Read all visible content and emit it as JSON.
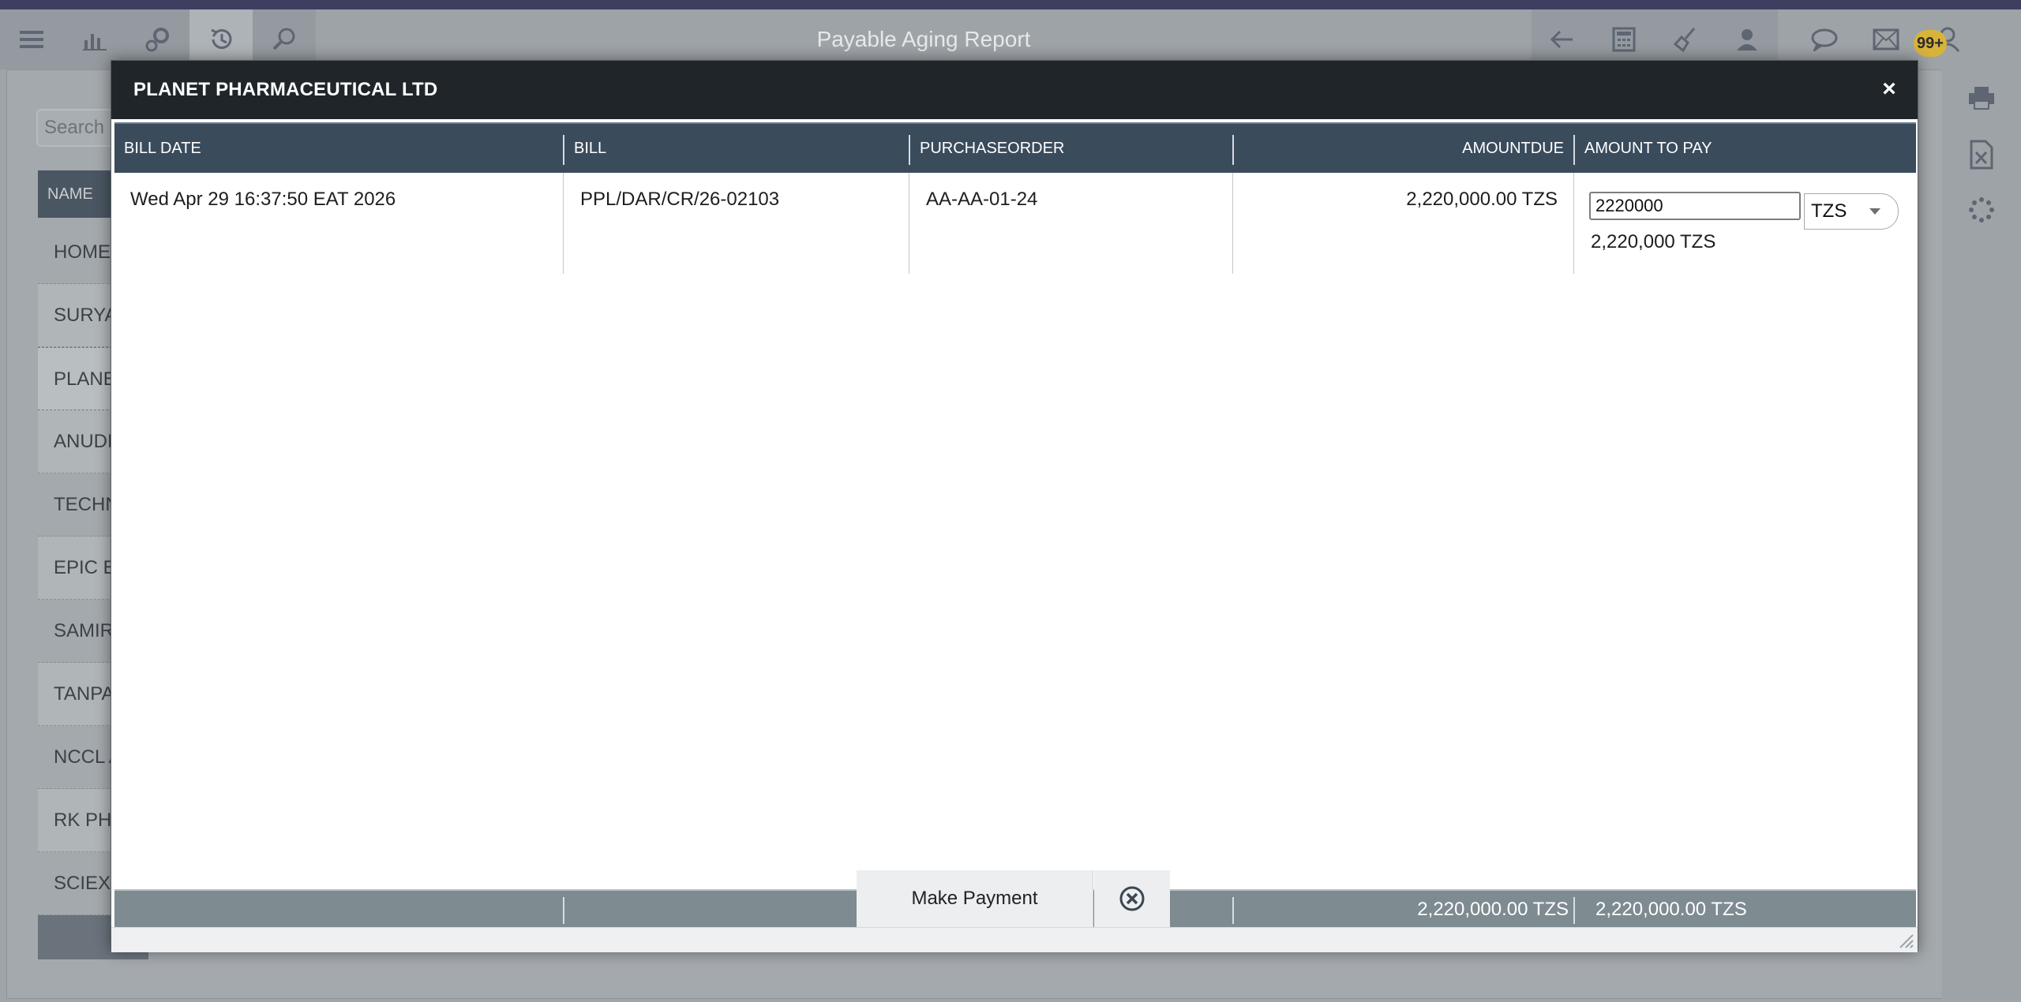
{
  "app": {
    "title": "Payable Aging Report",
    "notification_count": "99+",
    "search_placeholder": "Search",
    "list_header": "NAME",
    "list_items": [
      "HOME",
      "SURYA",
      "PLANE",
      "ANUDI",
      "TECHN",
      "EPIC E",
      "SAMIR",
      "TANPA",
      "NCCL A",
      "RK PH",
      "SCIEX"
    ]
  },
  "modal": {
    "title": "PLANET PHARMACEUTICAL LTD",
    "close_label": "×",
    "columns": {
      "bill_date": "BILL DATE",
      "bill": "BILL",
      "purchase_order": "PURCHASEORDER",
      "amount_due": "AMOUNTDUE",
      "amount_to_pay": "AMOUNT TO PAY"
    },
    "rows": [
      {
        "bill_date": "Wed Apr 29 16:37:50 EAT 2026",
        "bill": "PPL/DAR/CR/26-02103",
        "purchase_order": "AA-AA-01-24",
        "amount_due": "2,220,000.00 TZS",
        "amount_to_pay_value": "2220000",
        "currency": "TZS",
        "amount_to_pay_formatted": "2,220,000 TZS"
      }
    ],
    "totals": {
      "amount_due": "2,220,000.00 TZS",
      "amount_to_pay": "2,220,000.00 TZS"
    },
    "make_payment_label": "Make Payment"
  },
  "colors": {
    "header_bg": "#202529",
    "grid_header_bg": "#3a4b5c",
    "grid_footer_bg": "#7e8b90",
    "badge": "#d8b33a"
  }
}
